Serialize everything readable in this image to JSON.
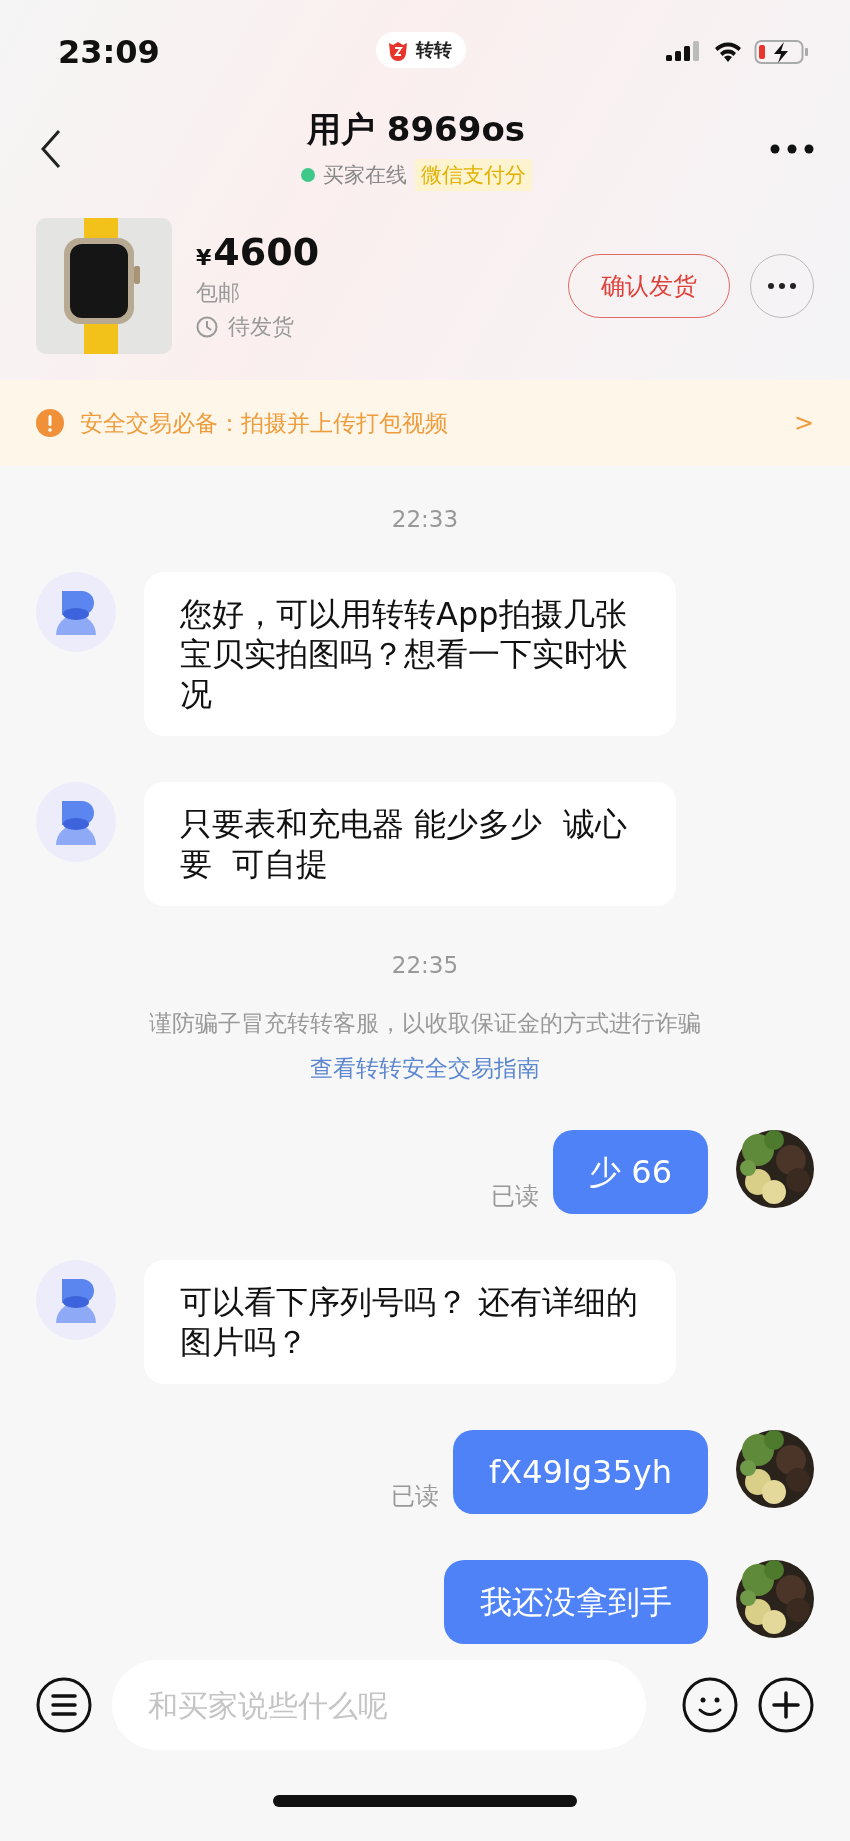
{
  "status_bar": {
    "time": "23:09",
    "app_badge": "转转"
  },
  "header": {
    "title": "用户 8969os",
    "online": true,
    "status_text": "买家在线",
    "tag": "微信支付分"
  },
  "product": {
    "price_symbol": "¥",
    "price": "4600",
    "shipping": "包邮",
    "state": "待发货",
    "action": "确认发货"
  },
  "banner": {
    "text": "安全交易必备：拍摄并上传打包视频",
    "arrow": ">"
  },
  "messages": [
    {
      "kind": "time",
      "text": "22:33"
    },
    {
      "kind": "received",
      "text": "您好，可以用转转App拍摄几张宝贝实拍图吗？想看一下实时状况"
    },
    {
      "kind": "received",
      "text": "只要表和充电器 能少多少  诚心要  可自提"
    },
    {
      "kind": "time",
      "text": "22:35"
    },
    {
      "kind": "notice",
      "text": "谨防骗子冒充转转客服，以收取保证金的方式进行诈骗",
      "link": "查看转转安全交易指南"
    },
    {
      "kind": "sent",
      "text": "少 66",
      "read_label": "已读"
    },
    {
      "kind": "received",
      "text": "可以看下序列号吗？ 还有详细的图片吗？"
    },
    {
      "kind": "sent",
      "text": "fX49lg35yh",
      "read_label": "已读"
    },
    {
      "kind": "sent",
      "text": "我还没拿到手"
    }
  ],
  "input": {
    "placeholder": "和买家说些什么呢"
  }
}
